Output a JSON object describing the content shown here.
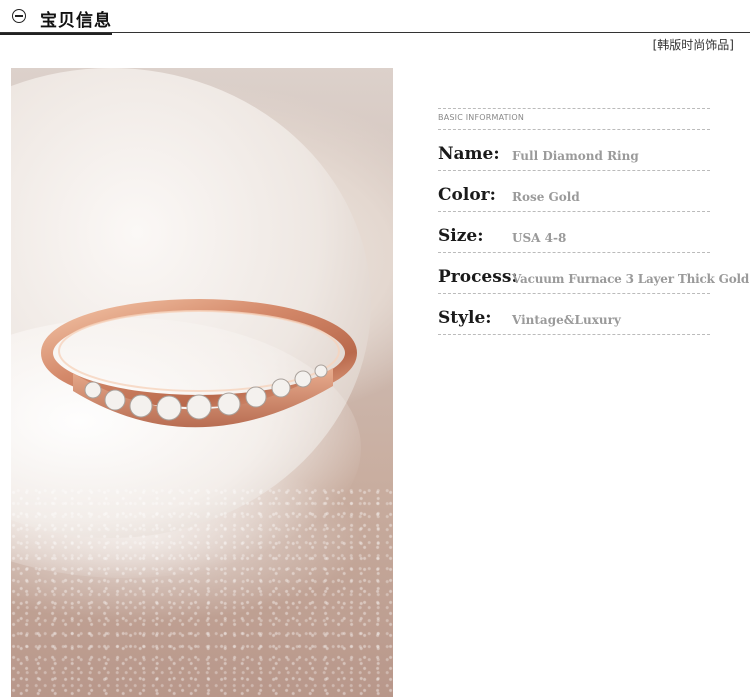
{
  "header": {
    "icon": "minus-circle-icon",
    "title": "宝贝信息",
    "tagline": "[韩版时尚饰品]"
  },
  "photo": {
    "subject": "rose-gold-ring-photo"
  },
  "info": {
    "heading": "BASIC INFORMATION",
    "rows": [
      {
        "label": "Name:",
        "value": "Full Diamond Ring"
      },
      {
        "label": "Color:",
        "value": "Rose Gold"
      },
      {
        "label": "Size:",
        "value": "USA 4-8"
      },
      {
        "label": "Process:",
        "value": "Vacuum Furnace 3 Layer Thick Gold"
      },
      {
        "label": "Style:",
        "value": "Vintage&Luxury"
      }
    ]
  },
  "colors": {
    "text_dark": "#1a1a1a",
    "value_gray": "#9a9a9a",
    "rose_gold": "#d08a6c"
  }
}
